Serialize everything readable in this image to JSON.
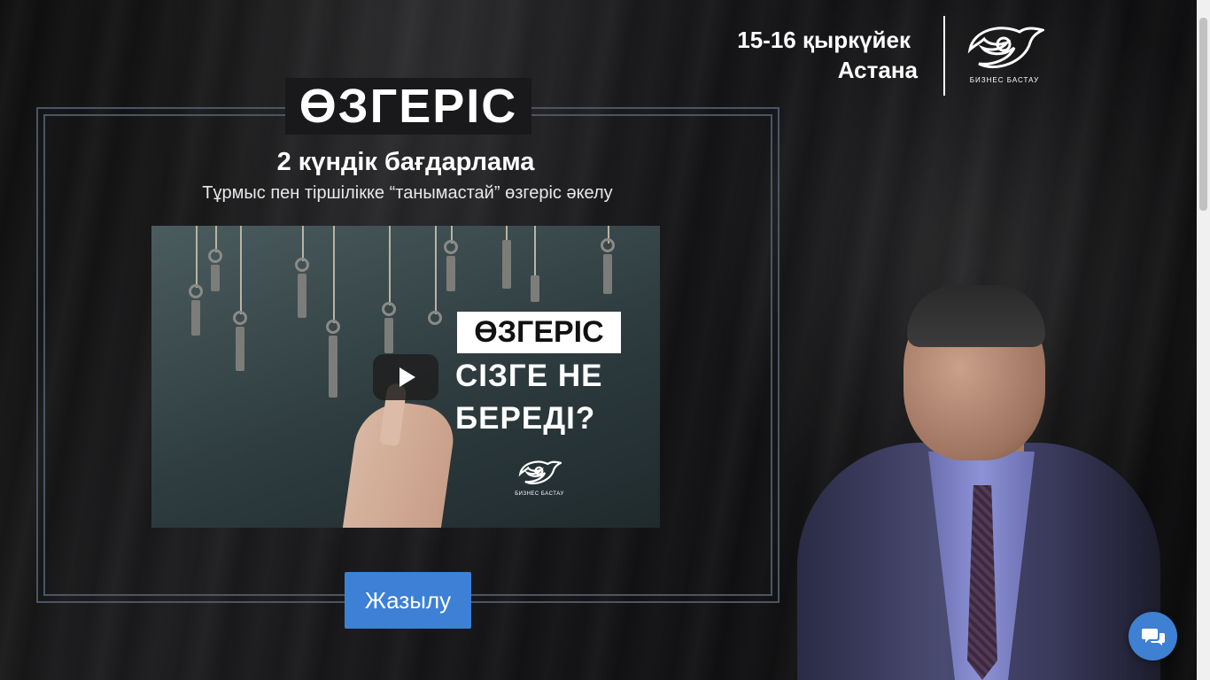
{
  "event": {
    "date": "15-16 қыркүйек",
    "city": "Астана"
  },
  "logo": {
    "text": "БИЗНЕС БАСТАУ"
  },
  "hero": {
    "title": "ӨЗГЕРІС",
    "program": "2 күндік бағдарлама",
    "subtitle": "Тұрмыс пен тіршілікке “танымастай” өзгеріс әкелу"
  },
  "video": {
    "badge": "ӨЗГЕРІС",
    "line1": "СІЗГЕ НЕ",
    "line2": "БЕРЕДІ?",
    "logo_text": "БИЗНЕС БАСТАУ",
    "play_icon": "play-icon"
  },
  "cta": {
    "label": "Жазылу"
  },
  "chat": {
    "icon": "chat-icon"
  },
  "colors": {
    "accent": "#3d80d6",
    "frame": "#4a5566",
    "background": "#141416"
  }
}
